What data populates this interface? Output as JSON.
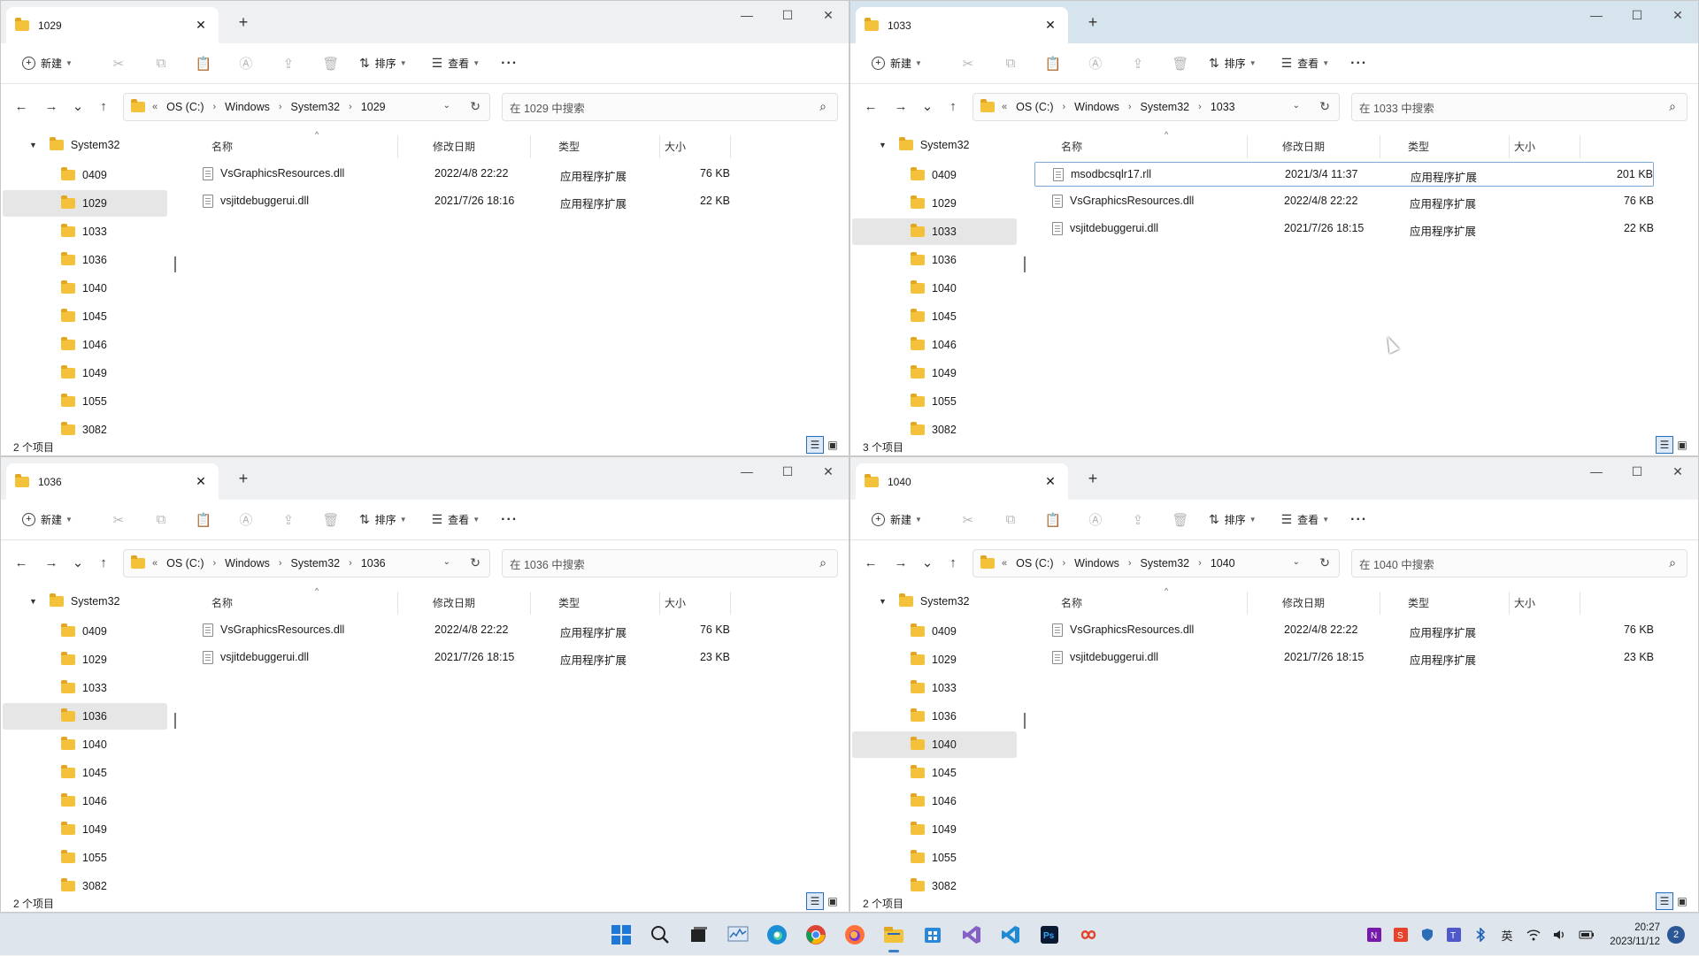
{
  "windows": [
    {
      "tab_title": "1029",
      "toolbar": {
        "new_label": "新建",
        "sort_label": "排序",
        "view_label": "查看"
      },
      "address": {
        "root": "OS (C:)",
        "crumbs": [
          "Windows",
          "System32",
          "1029"
        ]
      },
      "search_placeholder": "在 1029 中搜索",
      "tree_root": "System32",
      "tree_items": [
        "0409",
        "1029",
        "1033",
        "1036",
        "1040",
        "1045",
        "1046",
        "1049",
        "1055",
        "3082"
      ],
      "selected_tree": "1029",
      "columns": {
        "name": "名称",
        "date": "修改日期",
        "type": "类型",
        "size": "大小"
      },
      "files": [
        {
          "name": "VsGraphicsResources.dll",
          "date": "2022/4/8 22:22",
          "type": "应用程序扩展",
          "size": "76 KB"
        },
        {
          "name": "vsjitdebuggerui.dll",
          "date": "2021/7/26 18:16",
          "type": "应用程序扩展",
          "size": "22 KB"
        }
      ],
      "status": "2 个项目"
    },
    {
      "tab_title": "1033",
      "toolbar": {
        "new_label": "新建",
        "sort_label": "排序",
        "view_label": "查看"
      },
      "address": {
        "root": "OS (C:)",
        "crumbs": [
          "Windows",
          "System32",
          "1033"
        ]
      },
      "search_placeholder": "在 1033 中搜索",
      "tree_root": "System32",
      "tree_items": [
        "0409",
        "1029",
        "1033",
        "1036",
        "1040",
        "1045",
        "1046",
        "1049",
        "1055",
        "3082"
      ],
      "selected_tree": "1033",
      "columns": {
        "name": "名称",
        "date": "修改日期",
        "type": "类型",
        "size": "大小"
      },
      "files": [
        {
          "name": "msodbcsqlr17.rll",
          "date": "2021/3/4 11:37",
          "type": "应用程序扩展",
          "size": "201 KB"
        },
        {
          "name": "VsGraphicsResources.dll",
          "date": "2022/4/8 22:22",
          "type": "应用程序扩展",
          "size": "76 KB"
        },
        {
          "name": "vsjitdebuggerui.dll",
          "date": "2021/7/26 18:15",
          "type": "应用程序扩展",
          "size": "22 KB"
        }
      ],
      "status": "3 个项目"
    },
    {
      "tab_title": "1036",
      "toolbar": {
        "new_label": "新建",
        "sort_label": "排序",
        "view_label": "查看"
      },
      "address": {
        "root": "OS (C:)",
        "crumbs": [
          "Windows",
          "System32",
          "1036"
        ]
      },
      "search_placeholder": "在 1036 中搜索",
      "tree_root": "System32",
      "tree_items": [
        "0409",
        "1029",
        "1033",
        "1036",
        "1040",
        "1045",
        "1046",
        "1049",
        "1055",
        "3082"
      ],
      "selected_tree": "1036",
      "columns": {
        "name": "名称",
        "date": "修改日期",
        "type": "类型",
        "size": "大小"
      },
      "files": [
        {
          "name": "VsGraphicsResources.dll",
          "date": "2022/4/8 22:22",
          "type": "应用程序扩展",
          "size": "76 KB"
        },
        {
          "name": "vsjitdebuggerui.dll",
          "date": "2021/7/26 18:15",
          "type": "应用程序扩展",
          "size": "23 KB"
        }
      ],
      "status": "2 个项目"
    },
    {
      "tab_title": "1040",
      "toolbar": {
        "new_label": "新建",
        "sort_label": "排序",
        "view_label": "查看"
      },
      "address": {
        "root": "OS (C:)",
        "crumbs": [
          "Windows",
          "System32",
          "1040"
        ]
      },
      "search_placeholder": "在 1040 中搜索",
      "tree_root": "System32",
      "tree_items": [
        "0409",
        "1029",
        "1033",
        "1036",
        "1040",
        "1045",
        "1046",
        "1049",
        "1055",
        "3082"
      ],
      "selected_tree": "1040",
      "columns": {
        "name": "名称",
        "date": "修改日期",
        "type": "类型",
        "size": "大小"
      },
      "files": [
        {
          "name": "VsGraphicsResources.dll",
          "date": "2022/4/8 22:22",
          "type": "应用程序扩展",
          "size": "76 KB"
        },
        {
          "name": "vsjitdebuggerui.dll",
          "date": "2021/7/26 18:15",
          "type": "应用程序扩展",
          "size": "23 KB"
        }
      ],
      "status": "2 个项目"
    }
  ],
  "taskbar": {
    "apps": [
      "start-icon",
      "search-icon",
      "task-view-icon",
      "performance-monitor-icon",
      "edge-icon",
      "chrome-icon",
      "firefox-icon",
      "file-explorer-icon",
      "store-icon",
      "visual-studio-icon",
      "vscode-icon",
      "photoshop-icon",
      "infinity-app-icon"
    ],
    "tray_ime": "英",
    "time": "20:27",
    "date": "2023/11/12",
    "notification_count": "2"
  },
  "colors": {
    "accent": "#2b6cb8",
    "folder": "#f3c13a",
    "active_titlebar": "#d6e4ee"
  }
}
